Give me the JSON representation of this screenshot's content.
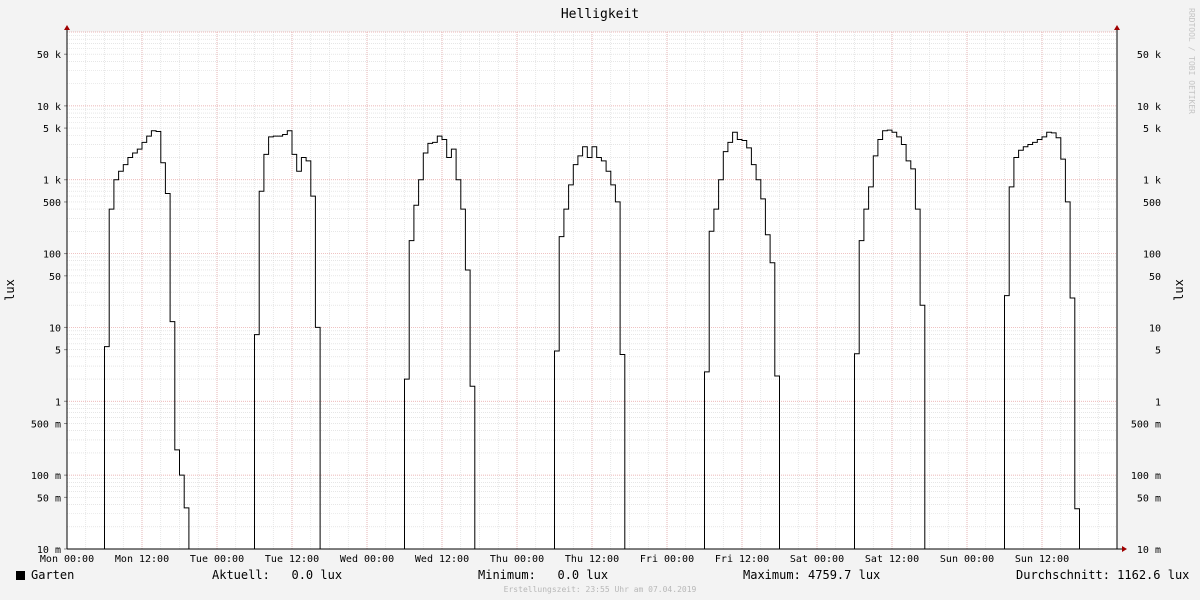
{
  "chart_data": {
    "type": "line",
    "title": "Helligkeit",
    "ylabel": "lux",
    "y_scale": "log",
    "ylim": [
      0.01,
      100000
    ],
    "y_ticks": [
      {
        "value": 50000,
        "label": "50 k"
      },
      {
        "value": 10000,
        "label": "10 k"
      },
      {
        "value": 5000,
        "label": "5 k"
      },
      {
        "value": 1000,
        "label": "1 k"
      },
      {
        "value": 500,
        "label": "500"
      },
      {
        "value": 100,
        "label": "100"
      },
      {
        "value": 50,
        "label": "50"
      },
      {
        "value": 10,
        "label": "10"
      },
      {
        "value": 5,
        "label": "5"
      },
      {
        "value": 1,
        "label": "1"
      },
      {
        "value": 0.5,
        "label": "500 m"
      },
      {
        "value": 0.1,
        "label": "100 m"
      },
      {
        "value": 0.05,
        "label": "50 m"
      },
      {
        "value": 0.01,
        "label": "10 m"
      }
    ],
    "xlim_hours": [
      0,
      168
    ],
    "x_ticks": [
      {
        "hour": 0,
        "label": "Mon 00:00"
      },
      {
        "hour": 12,
        "label": "Mon 12:00"
      },
      {
        "hour": 24,
        "label": "Tue 00:00"
      },
      {
        "hour": 36,
        "label": "Tue 12:00"
      },
      {
        "hour": 48,
        "label": "Wed 00:00"
      },
      {
        "hour": 60,
        "label": "Wed 12:00"
      },
      {
        "hour": 72,
        "label": "Thu 00:00"
      },
      {
        "hour": 84,
        "label": "Thu 12:00"
      },
      {
        "hour": 96,
        "label": "Fri 00:00"
      },
      {
        "hour": 108,
        "label": "Fri 12:00"
      },
      {
        "hour": 120,
        "label": "Sat 00:00"
      },
      {
        "hour": 132,
        "label": "Sat 12:00"
      },
      {
        "hour": 144,
        "label": "Sun 00:00"
      },
      {
        "hour": 156,
        "label": "Sun 12:00"
      }
    ],
    "series": [
      {
        "name": "Garten",
        "color": "#000000",
        "days": [
          {
            "start_hour": 6.0,
            "values": [
              5.5,
              400,
              1000,
              1300,
              1600,
              2000,
              2300,
              2600,
              3200,
              3900,
              4600,
              4500,
              1700,
              650,
              12,
              0.22,
              0.1,
              0.036
            ]
          },
          {
            "start_hour": 30.0,
            "values": [
              8,
              700,
              2200,
              3800,
              3900,
              3900,
              4100,
              4600,
              2200,
              1300,
              2000,
              1800,
              600,
              10
            ]
          },
          {
            "start_hour": 54.0,
            "values": [
              2,
              150,
              450,
              1000,
              2300,
              3100,
              3200,
              3900,
              3500,
              2000,
              2600,
              1000,
              400,
              60,
              1.6
            ]
          },
          {
            "start_hour": 78.0,
            "values": [
              4.8,
              170,
              400,
              850,
              1600,
              2100,
              2800,
              2000,
              2800,
              2000,
              1800,
              1300,
              850,
              500,
              4.3
            ]
          },
          {
            "start_hour": 102.0,
            "values": [
              2.5,
              200,
              400,
              1000,
              2400,
              3200,
              4400,
              3500,
              3400,
              2700,
              1600,
              1000,
              550,
              180,
              75,
              2.2
            ]
          },
          {
            "start_hour": 126.0,
            "values": [
              4.4,
              150,
              400,
              800,
              2100,
              3500,
              4600,
              4700,
              4400,
              3800,
              3000,
              1800,
              1400,
              400,
              20
            ]
          },
          {
            "start_hour": 150.0,
            "values": [
              27,
              800,
              2000,
              2500,
              2800,
              3000,
              3200,
              3500,
              3800,
              4400,
              4300,
              3700,
              1900,
              500,
              25,
              0.035
            ]
          }
        ]
      }
    ],
    "legend_placement": "bottom-left",
    "grid": true
  },
  "legend": {
    "series_name": "Garten",
    "stats": [
      {
        "label": "Aktuell:",
        "value": "0.0 lux"
      },
      {
        "label": "Minimum:",
        "value": "0.0 lux"
      },
      {
        "label": "Maximum:",
        "value": "4759.7 lux"
      },
      {
        "label": "Durchschnitt:",
        "value": "1162.6 lux"
      }
    ]
  },
  "footer": "Erstellungszeit: 23:55 Uhr am 07.04.2019",
  "watermark": "RRDTOOL / TOBI OETIKER",
  "colors": {
    "background": "#f3f3f3",
    "plot_background": "#ffffff",
    "grid_major": "#e6a0a0",
    "grid_minor": "#d8d8d8",
    "line": "#000000",
    "axis_arrow": "#a00000"
  }
}
